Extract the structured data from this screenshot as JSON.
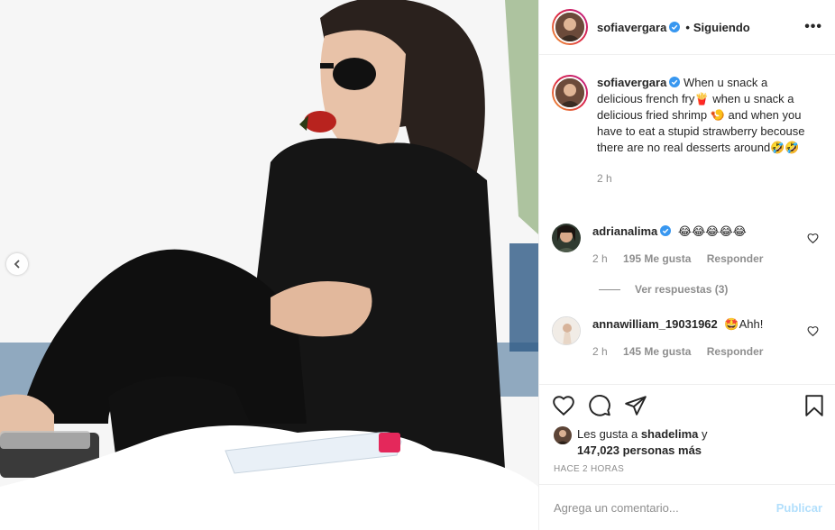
{
  "post": {
    "username": "sofiavergara",
    "follow_status": "Siguiendo",
    "dot": "•",
    "more_label": "•••"
  },
  "caption": {
    "username": "sofiavergara",
    "text_1": "When u snack a delicious french fry",
    "emoji_1": "🍟",
    "text_2": " when u snack a delicious fried shrimp ",
    "emoji_2": "🍤",
    "text_3": " and when you have to eat a stupid strawberry becouse there are no real desserts around",
    "emoji_3": "🤣🤣",
    "time": "2 h"
  },
  "comments": [
    {
      "username": "adrianalima",
      "text": "😂😂😂😂😂",
      "time": "2 h",
      "likes": "195 Me gusta",
      "reply": "Responder",
      "view_replies": "Ver respuestas (3)"
    },
    {
      "username": "annawilliam_19031962",
      "text": "🤩Ahh!",
      "time": "2 h",
      "likes": "145 Me gusta",
      "reply": "Responder"
    }
  ],
  "likes": {
    "prefix": "Les gusta a ",
    "user": "shadelima",
    "mid": " y",
    "count": "147,023 personas más"
  },
  "posted_ago": "HACE 2 HORAS",
  "add_comment": {
    "placeholder": "Agrega un comentario...",
    "post_label": "Publicar"
  },
  "colors": {
    "verified": "#3897f0",
    "post_button": "#b2dffc",
    "muted": "#8e8e8e"
  }
}
